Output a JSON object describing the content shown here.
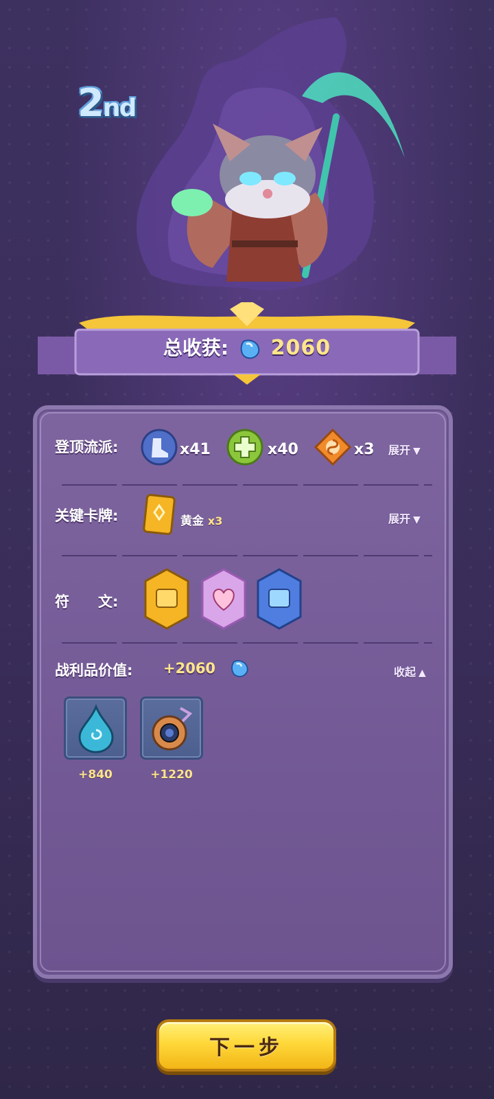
{
  "rank": {
    "main": "2",
    "suffix": "nd"
  },
  "total": {
    "label": "总收获:",
    "value": "2060",
    "icon": "blue-gem-icon"
  },
  "rows": {
    "schools": {
      "label": "登顶流派:",
      "items": [
        {
          "icon": "boot-school-icon",
          "count": "x41",
          "color": "#4f6fc8"
        },
        {
          "icon": "heal-cross-school-icon",
          "count": "x40",
          "color": "#8cc63a"
        },
        {
          "icon": "flame-swirl-school-icon",
          "count": "x3",
          "color": "#f08a2a"
        }
      ],
      "toggle": "展开"
    },
    "key_cards": {
      "label": "关键卡牌:",
      "card_name": "黄金",
      "card_count": "x3",
      "icon": "gold-card-icon",
      "toggle": "展开"
    },
    "runes": {
      "label": "符　　文:",
      "items": [
        {
          "icon": "gold-chest-rune-icon",
          "color": "#f5b524"
        },
        {
          "icon": "heart-rune-icon",
          "color": "#e9b6f0"
        },
        {
          "icon": "blue-chest-rune-icon",
          "color": "#4f7ee0"
        }
      ]
    },
    "loot": {
      "label": "战利品价值:",
      "value": "+2060",
      "icon": "blue-gem-icon",
      "toggle": "收起",
      "items": [
        {
          "icon": "water-drop-icon",
          "value": "+840"
        },
        {
          "icon": "amulet-icon",
          "value": "+1220"
        }
      ]
    }
  },
  "next_button": "下一步"
}
